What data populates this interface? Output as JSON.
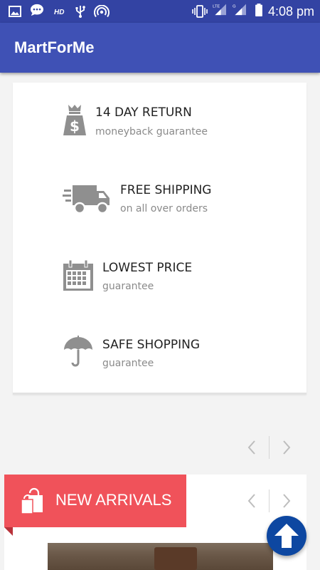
{
  "status_bar": {
    "time": "4:08 pm",
    "left_icons": [
      "image-icon",
      "chat-icon",
      "hd-icon",
      "usb-icon",
      "hotspot-icon"
    ],
    "right_icons": [
      "vibrate-icon",
      "lte-signal-icon",
      "g-signal-icon",
      "battery-icon"
    ],
    "hd_text": "HD",
    "lte_text": "LTE",
    "g_text": "G"
  },
  "app_bar": {
    "title": "MartForMe"
  },
  "features": [
    {
      "title": "14 DAY RETURN",
      "subtitle": "moneyback guarantee",
      "icon": "money-bag-icon"
    },
    {
      "title": "FREE SHIPPING",
      "subtitle": "on all over orders",
      "icon": "truck-icon"
    },
    {
      "title": "LOWEST PRICE",
      "subtitle": "guarantee",
      "icon": "calendar-icon"
    },
    {
      "title": "SAFE SHOPPING",
      "subtitle": "guarantee",
      "icon": "umbrella-icon"
    }
  ],
  "new_arrivals": {
    "title": "NEW ARRIVALS",
    "icon": "shopping-bags-icon"
  },
  "colors": {
    "primary": "#3f51b5",
    "status_bar": "#3343a3",
    "arrivals_accent": "#f0525a",
    "fab": "#0d47a1",
    "feature_icon": "#8f8f8f"
  }
}
